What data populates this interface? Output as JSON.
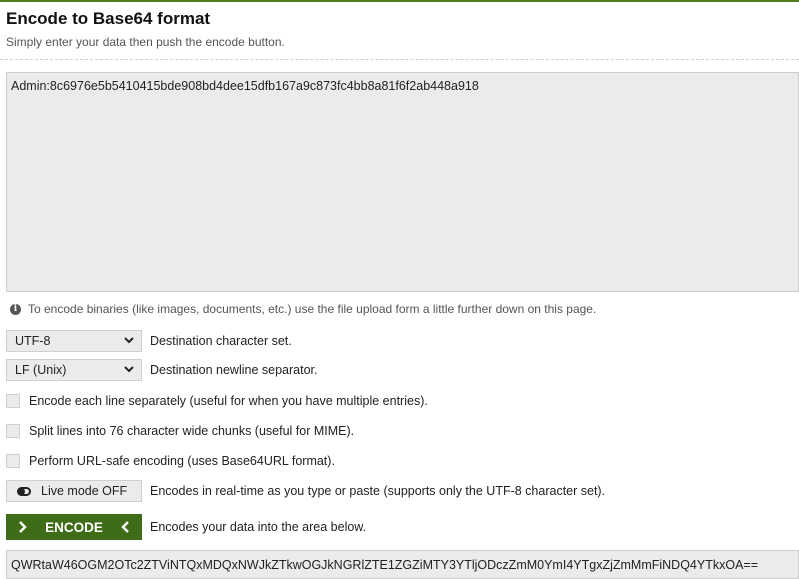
{
  "header": {
    "title": "Encode to Base64 format",
    "subtitle": "Simply enter your data then push the encode button."
  },
  "input": {
    "value": "Admin:8c6976e5b5410415bde908bd4dee15dfb167a9c873fc4bb8a81f6f2ab448a918"
  },
  "info_text": "To encode binaries (like images, documents, etc.) use the file upload form a little further down on this page.",
  "charset": {
    "selected": "UTF-8",
    "label": "Destination character set."
  },
  "newline": {
    "selected": "LF (Unix)",
    "label": "Destination newline separator."
  },
  "options": [
    {
      "label": "Encode each line separately (useful for when you have multiple entries)."
    },
    {
      "label": "Split lines into 76 character wide chunks (useful for MIME)."
    },
    {
      "label": "Perform URL-safe encoding (uses Base64URL format)."
    }
  ],
  "live_mode": {
    "button_label": "Live mode OFF",
    "description": "Encodes in real-time as you type or paste (supports only the UTF-8 character set)."
  },
  "encode": {
    "button_label": "ENCODE",
    "description": "Encodes your data into the area below."
  },
  "output": {
    "value": "QWRtaW46OGM2OTc2ZTViNTQxMDQxNWJkZTkwOGJkNGRlZTE1ZGZiMTY3YTljODczZmM0YmI4YTgxZjZmMmFiNDQ4YTkxOA=="
  },
  "colors": {
    "accent_green": "#3f6d17",
    "field_bg": "#ebebeb",
    "border": "#cfcfcf"
  }
}
